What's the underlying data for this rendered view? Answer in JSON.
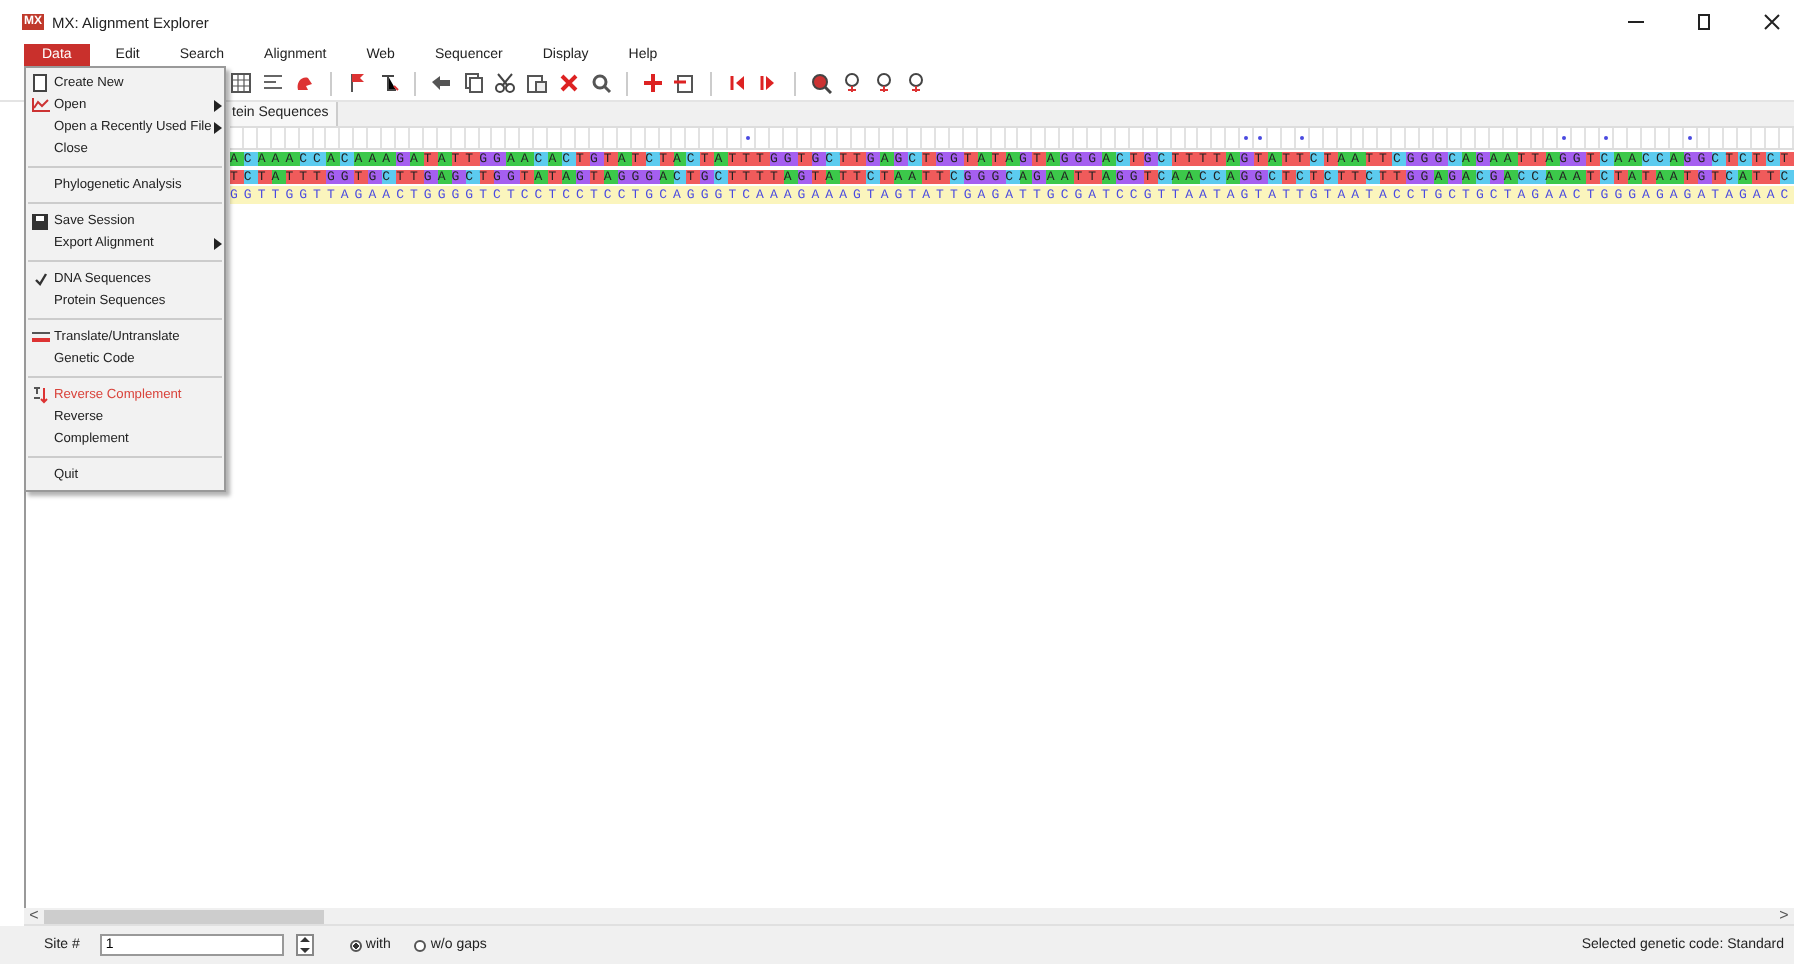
{
  "window": {
    "title": "MX: Alignment Explorer",
    "logo": "MX"
  },
  "menubar": [
    {
      "label": "Data",
      "selected": true
    },
    {
      "label": "Edit",
      "selected": false
    },
    {
      "label": "Search",
      "selected": false
    },
    {
      "label": "Alignment",
      "selected": false
    },
    {
      "label": "Web",
      "selected": false
    },
    {
      "label": "Sequencer",
      "selected": false
    },
    {
      "label": "Display",
      "selected": false
    },
    {
      "label": "Help",
      "selected": false
    }
  ],
  "menu": {
    "items": [
      {
        "kind": "item",
        "label": "Create New",
        "submenu": false,
        "checked": false,
        "highlighted": false
      },
      {
        "kind": "item",
        "label": "Open",
        "submenu": true,
        "checked": false,
        "highlighted": false
      },
      {
        "kind": "item",
        "label": "Open a Recently Used File",
        "submenu": true,
        "checked": false,
        "highlighted": false
      },
      {
        "kind": "item",
        "label": "Close",
        "submenu": false,
        "checked": false,
        "highlighted": false
      },
      {
        "kind": "separator"
      },
      {
        "kind": "item",
        "label": "Phylogenetic Analysis",
        "submenu": false,
        "checked": false,
        "highlighted": false
      },
      {
        "kind": "separator"
      },
      {
        "kind": "item",
        "label": "Save Session",
        "submenu": false,
        "checked": false,
        "highlighted": false
      },
      {
        "kind": "item",
        "label": "Export Alignment",
        "submenu": true,
        "checked": false,
        "highlighted": false
      },
      {
        "kind": "separator"
      },
      {
        "kind": "item",
        "label": "DNA Sequences",
        "submenu": false,
        "checked": true,
        "highlighted": false
      },
      {
        "kind": "item",
        "label": "Protein Sequences",
        "submenu": false,
        "checked": false,
        "highlighted": false
      },
      {
        "kind": "separator"
      },
      {
        "kind": "item",
        "label": "Translate/Untranslate",
        "submenu": false,
        "checked": false,
        "highlighted": false
      },
      {
        "kind": "item",
        "label": "Genetic Code",
        "submenu": false,
        "checked": false,
        "highlighted": false
      },
      {
        "kind": "separator"
      },
      {
        "kind": "item",
        "label": "Reverse Complement",
        "submenu": false,
        "checked": false,
        "highlighted": true
      },
      {
        "kind": "item",
        "label": "Reverse",
        "submenu": false,
        "checked": false,
        "highlighted": false
      },
      {
        "kind": "item",
        "label": "Complement",
        "submenu": false,
        "checked": false,
        "highlighted": false
      },
      {
        "kind": "separator"
      },
      {
        "kind": "item",
        "label": "Quit",
        "submenu": false,
        "checked": false,
        "highlighted": false
      }
    ]
  },
  "tabs": [
    {
      "label": "tein Sequences",
      "selected": false
    }
  ],
  "ruler": {
    "conserved": [
      false,
      false,
      false,
      false,
      false,
      false,
      false,
      false,
      false,
      false,
      false,
      false,
      false,
      false,
      false,
      false,
      false,
      false,
      false,
      false,
      false,
      false,
      false,
      false,
      false,
      false,
      false,
      false,
      false,
      false,
      false,
      false,
      false,
      false,
      false,
      false,
      false,
      true,
      false,
      false,
      false,
      false,
      false,
      false,
      false,
      false,
      false,
      false,
      false,
      false,
      false,
      false,
      false,
      false,
      false,
      false,
      false,
      false,
      false,
      false,
      false,
      false,
      false,
      false,
      false,
      false,
      false,
      false,
      false,
      false,
      false,
      false,
      false,
      true,
      true,
      false,
      false,
      true,
      false,
      false,
      false,
      false,
      false,
      false,
      false,
      false,
      false,
      false,
      false,
      false,
      false,
      false,
      false,
      false,
      false,
      false,
      true,
      false,
      false,
      true,
      false,
      false,
      false,
      false,
      false,
      true,
      false,
      false,
      false,
      false,
      false,
      false,
      false
    ]
  },
  "scrollbar": {
    "left": "<",
    "right": ">"
  },
  "sequences": [
    {
      "bases": "ACAAACCACAAAGATATTGGAACACTGTATCTACTATTTGGTGCTTGAGCTGGTATAGTAGGGACTGCTTTTAGTATTCTAATTCGGGCAGAATTAGGTCAACCAGGCTCTCT",
      "colored": true
    },
    {
      "bases": "TCTATTTGGTGCTTGAGCTGGTATAGTAGGGACTGCTTTTAGTATTCTAATTCGGGCAGAATTAGGTCAACCAGGCTCTCTTCTTGGAGACGACCAAATCTATAATGTCATTC",
      "colored": true
    },
    {
      "bases": "GGTTGGTTAGAACTGGGGTCTCCTCCTCCTGCAGGGTCAAAGAAAGTAGTATTGAGATTGCGATCCGTTAATAGTATTGTAATACCTGCTGCTAGAACTGGGAGAGATAGAAC",
      "colored": false
    }
  ],
  "status": {
    "site_label": "Site #",
    "site_value": "1",
    "options": [
      {
        "label": "with",
        "selected": true
      },
      {
        "label": "w/o gaps",
        "selected": false
      }
    ],
    "genetic_code": "Selected genetic code: Standard"
  }
}
